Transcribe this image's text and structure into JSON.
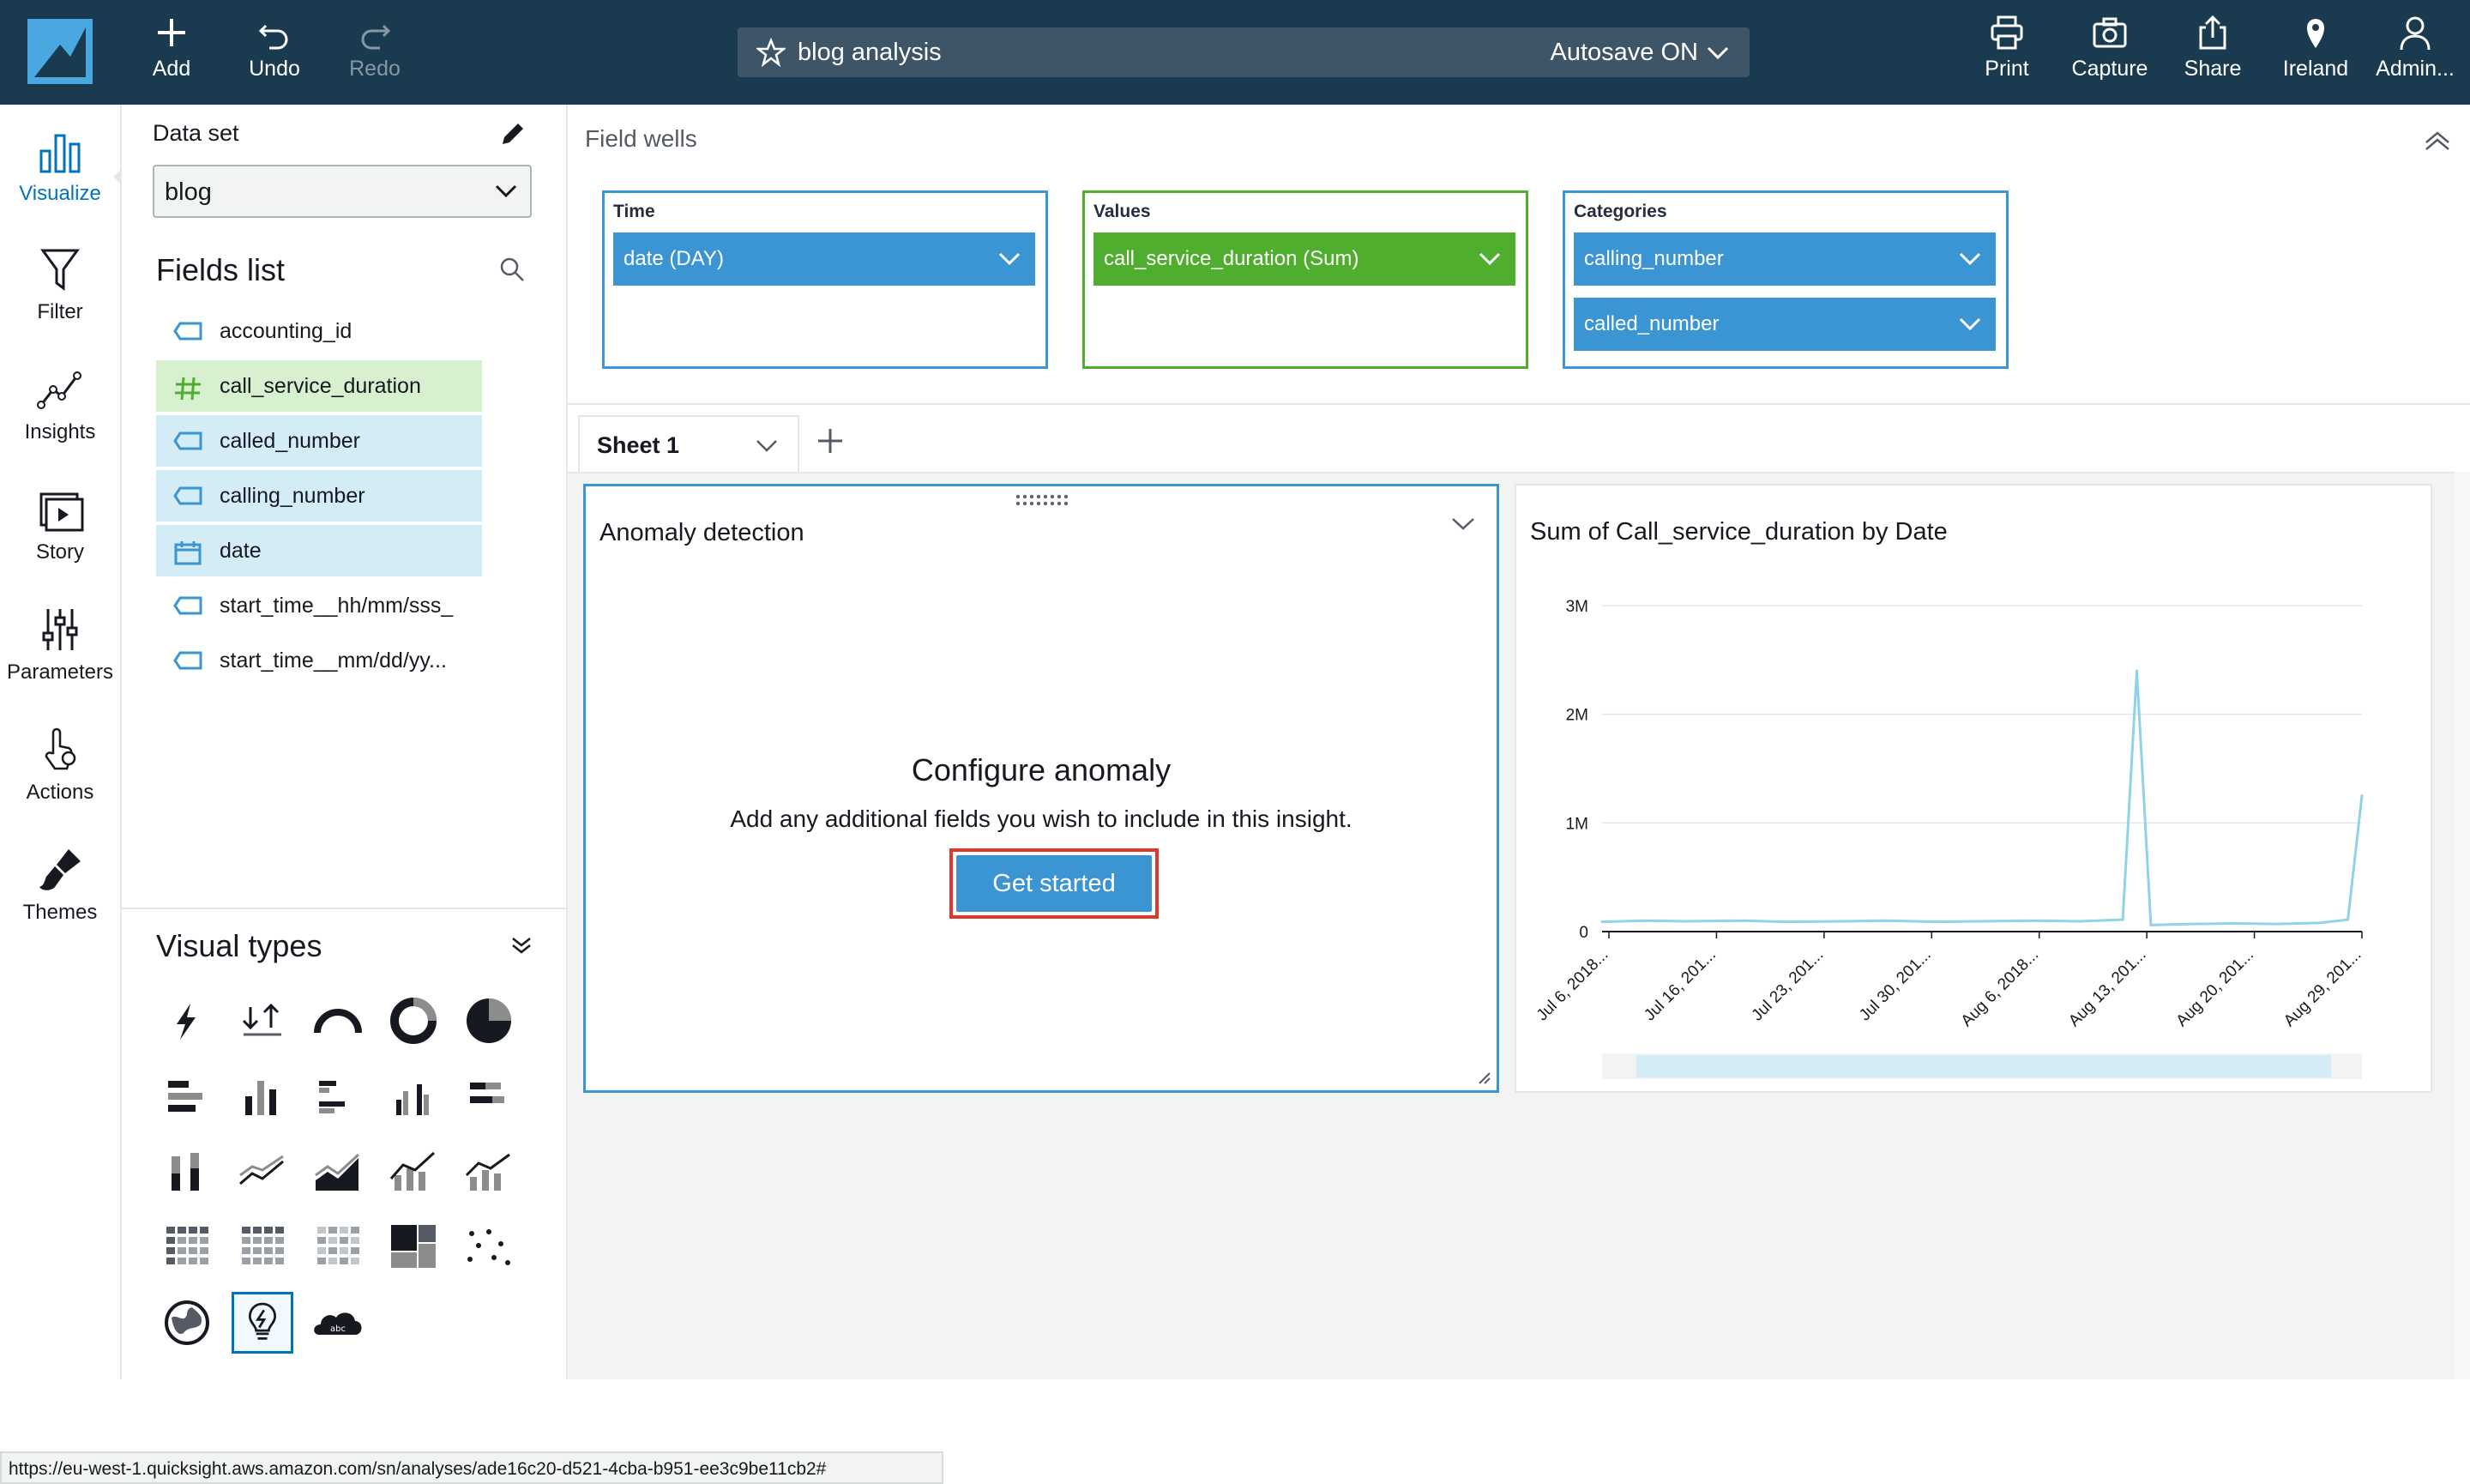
{
  "toolbar": {
    "add_label": "Add",
    "undo_label": "Undo",
    "redo_label": "Redo",
    "analysis_title": "blog analysis",
    "autosave_label": "Autosave ON",
    "print_label": "Print",
    "capture_label": "Capture",
    "share_label": "Share",
    "region_label": "Ireland",
    "user_label": "Admin..."
  },
  "rail": {
    "items": [
      {
        "label": "Visualize",
        "icon": "bar-chart-icon",
        "active": true
      },
      {
        "label": "Filter",
        "icon": "filter-icon"
      },
      {
        "label": "Insights",
        "icon": "insights-icon"
      },
      {
        "label": "Story",
        "icon": "story-icon"
      },
      {
        "label": "Parameters",
        "icon": "parameters-icon"
      },
      {
        "label": "Actions",
        "icon": "actions-icon"
      },
      {
        "label": "Themes",
        "icon": "themes-icon"
      }
    ]
  },
  "dataset": {
    "label": "Data set",
    "value": "blog"
  },
  "fields_list": {
    "title": "Fields list",
    "items": [
      {
        "name": "accounting_id",
        "type": "dimension"
      },
      {
        "name": "call_service_duration",
        "type": "measure",
        "selected": "green"
      },
      {
        "name": "called_number",
        "type": "dimension",
        "selected": "blue"
      },
      {
        "name": "calling_number",
        "type": "dimension",
        "selected": "blue"
      },
      {
        "name": "date",
        "type": "date",
        "selected": "blue"
      },
      {
        "name": "start_time__hh/mm/sss_",
        "type": "dimension"
      },
      {
        "name": "start_time__mm/dd/yy...",
        "type": "dimension"
      }
    ]
  },
  "visual_types": {
    "title": "Visual types"
  },
  "field_wells": {
    "title": "Field wells",
    "time_label": "Time",
    "time_value": "date (DAY)",
    "values_label": "Values",
    "values_value": "call_service_duration (Sum)",
    "categories_label": "Categories",
    "categories_values": [
      "calling_number",
      "called_number"
    ]
  },
  "sheet": {
    "tab_label": "Sheet 1"
  },
  "anomaly_visual": {
    "title": "Anomaly detection",
    "configure_title": "Configure anomaly",
    "configure_desc": "Add any additional fields you wish to include in this insight.",
    "button_label": "Get started"
  },
  "line_visual": {
    "title": "Sum of Call_service_duration by Date"
  },
  "chart_data": {
    "type": "line",
    "title": "Sum of Call_service_duration by Date",
    "xlabel": "",
    "ylabel": "",
    "ylim": [
      0,
      3000000
    ],
    "y_ticks": [
      "0",
      "1M",
      "2M",
      "3M"
    ],
    "x_ticks": [
      "Jul 6, 2018...",
      "Jul 16, 201...",
      "Jul 23, 201...",
      "Jul 30, 201...",
      "Aug 6, 2018...",
      "Aug 13, 201...",
      "Aug 20, 201...",
      "Aug 29, 201..."
    ],
    "series_color": "#8fd3e8",
    "series": [
      {
        "x": [
          "2018-07-06",
          "2018-07-09",
          "2018-07-12",
          "2018-07-16",
          "2018-07-19",
          "2018-07-23",
          "2018-07-26",
          "2018-07-30",
          "2018-08-02",
          "2018-08-06",
          "2018-08-09",
          "2018-08-12",
          "2018-08-13",
          "2018-08-14",
          "2018-08-17",
          "2018-08-20",
          "2018-08-23",
          "2018-08-26",
          "2018-08-28",
          "2018-08-29"
        ],
        "values": [
          90000,
          100000,
          95000,
          100000,
          90000,
          95000,
          100000,
          90000,
          95000,
          100000,
          95000,
          110000,
          2400000,
          60000,
          70000,
          75000,
          70000,
          80000,
          110000,
          1250000
        ]
      }
    ]
  },
  "status_url": "https://eu-west-1.quicksight.aws.amazon.com/sn/analyses/ade16c20-d521-4cba-b951-ee3c9be11cb2#"
}
